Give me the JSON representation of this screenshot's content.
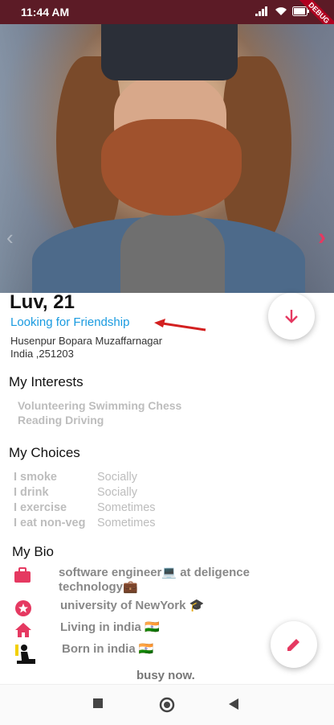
{
  "status": {
    "time": "11:44 AM",
    "debug": "DEBUG"
  },
  "profile": {
    "name_age": "Luv, 21",
    "looking_for": "Looking for  Friendship",
    "address_line1": "Husenpur Bopara  Muzaffarnagar",
    "address_line2": " India ,251203"
  },
  "interests": {
    "title": "My Interests",
    "text": "Volunteering Swimming Chess Reading Driving"
  },
  "choices": {
    "title": "My Choices",
    "rows": [
      {
        "key": "I smoke",
        "value": "Socially"
      },
      {
        "key": "I drink",
        "value": "Socially"
      },
      {
        "key": "I exercise",
        "value": "Sometimes"
      },
      {
        "key": "I eat non-veg",
        "value": "Sometimes"
      }
    ]
  },
  "bio": {
    "title": "My Bio",
    "items": [
      {
        "icon": "briefcase-icon",
        "text": "software engineer💻 at deligence technology💼"
      },
      {
        "icon": "star-badge-icon",
        "text": "university of NewYork 🎓"
      },
      {
        "icon": "home-icon",
        "text": "Living in india 🇮🇳"
      },
      {
        "icon": "baby-icon",
        "text": " Born in india 🇮🇳"
      }
    ],
    "status": "busy now."
  },
  "colors": {
    "accent": "#e53961",
    "link": "#1a9be0",
    "statusbar": "#5c1b26"
  }
}
